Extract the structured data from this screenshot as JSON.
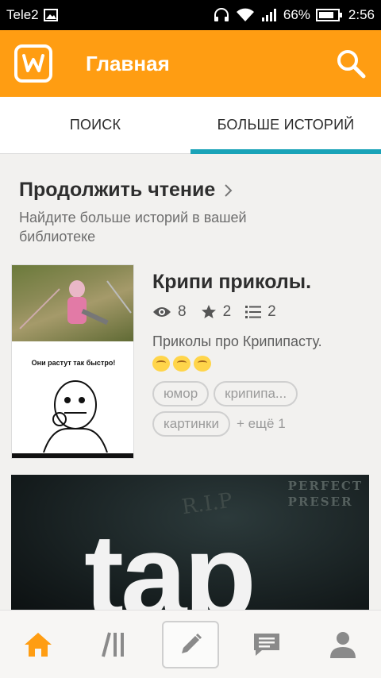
{
  "statusbar": {
    "carrier": "Tele2",
    "battery": "66%",
    "time": "2:56",
    "icons": [
      "image-icon",
      "headphones-icon",
      "wifi-icon",
      "signal-icon",
      "battery-icon"
    ]
  },
  "appbar": {
    "title": "Главная",
    "logo_icon": "wattpad-logo",
    "search_icon": "search-icon",
    "color": "#ff9d12"
  },
  "tabs": [
    {
      "label": "ПОИСК",
      "active": false
    },
    {
      "label": "БОЛЬШЕ ИСТОРИЙ",
      "active": true
    }
  ],
  "accent": "#1aa3b8",
  "section": {
    "title": "Продолжить чтение",
    "subtitle": "Найдите больше историй в вашей библиотеке"
  },
  "story": {
    "title": "Крипи приколы.",
    "cover_caption": "Они растут так быстро!",
    "views": "8",
    "votes": "2",
    "parts": "2",
    "description": "Приколы про Крипипасту.",
    "tags": [
      "юмор",
      "крипипа...",
      "картинки"
    ],
    "more_tags": "+ ещё 1"
  },
  "promo": {
    "big_text": "tap",
    "rip_text": "R.I.P",
    "corner_text_1": "PERFECT",
    "corner_text_2": "PRESER"
  },
  "bottomnav": [
    "home-icon",
    "library-icon",
    "write-icon",
    "messages-icon",
    "profile-icon"
  ]
}
